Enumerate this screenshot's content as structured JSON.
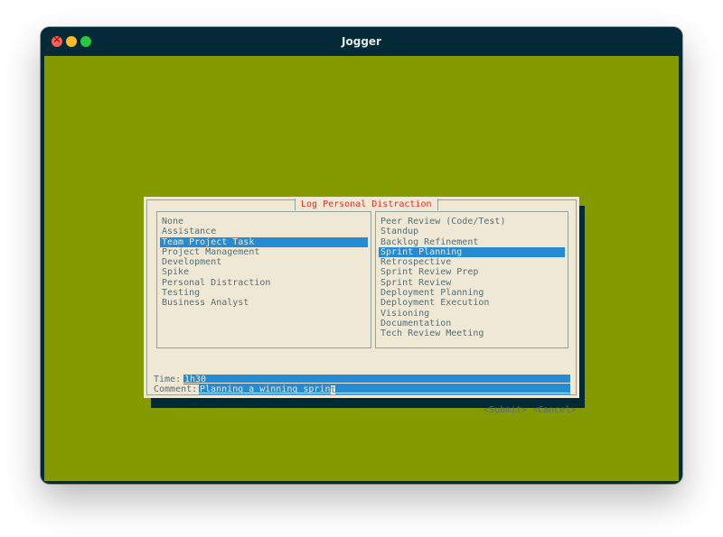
{
  "window": {
    "title": "Jogger"
  },
  "dialog": {
    "title": "Log Personal Distraction",
    "left_list": {
      "items": [
        "None",
        "Assistance",
        "Team Project Task",
        "Project Management",
        "Development",
        "Spike",
        "Personal Distraction",
        "Testing",
        "Business Analyst"
      ],
      "selected": "Team Project Task"
    },
    "right_list": {
      "items": [
        "Peer Review (Code/Test)",
        "Standup",
        "Backlog Refinement",
        "Sprint Planning",
        "Retrospective",
        "Sprint Review Prep",
        "Sprint Review",
        "Deployment Planning",
        "Deployment Execution",
        "Visioning",
        "Documentation",
        "Tech Review Meeting"
      ],
      "selected": "Sprint Planning"
    },
    "time": {
      "label": "Time:",
      "value": "1h30"
    },
    "comment": {
      "label": "Comment:",
      "value": "Planning a winning sprin",
      "cursor_char": "t"
    },
    "buttons": {
      "submit": "<Submit>",
      "cancel": "<Cancel>"
    }
  },
  "colors": {
    "terminal_bg": "#859900",
    "dialog_bg": "#eee8d5",
    "highlight": "#268bd2",
    "title_text": "#dc322f",
    "window_chrome": "#002b36"
  }
}
